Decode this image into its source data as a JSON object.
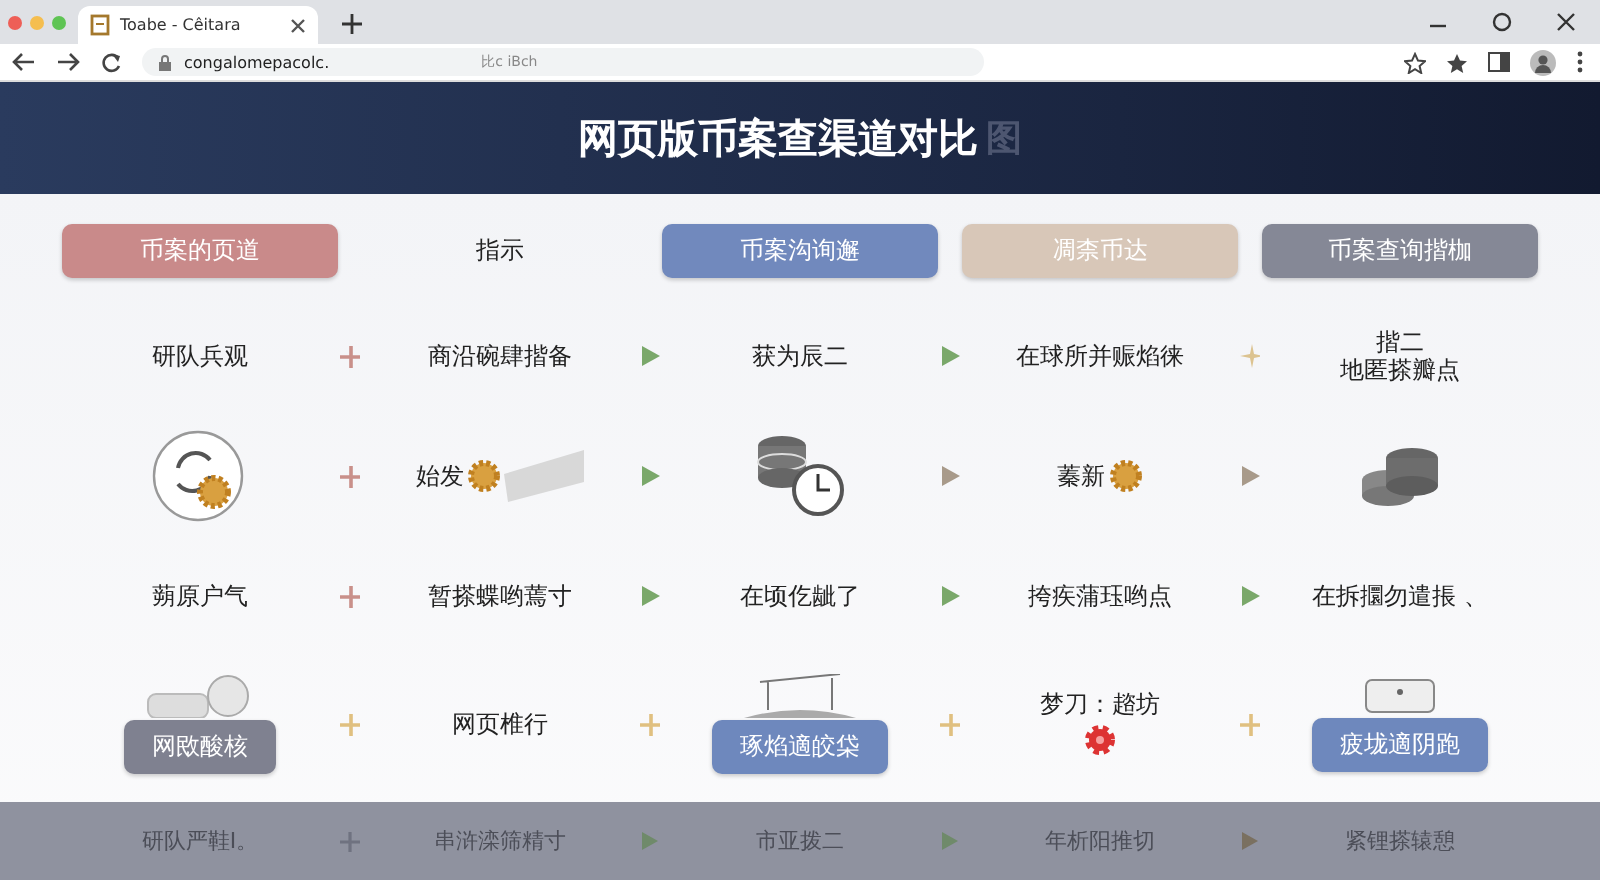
{
  "browser": {
    "tab_title": "Toabe - Cêitara",
    "url": "congalomepacolc.",
    "url_hint": "比c iBch"
  },
  "banner": {
    "title": "网页版币案查渠道对比",
    "badge": "图"
  },
  "header": [
    {
      "kind": "pill",
      "text": "币案的页道",
      "color": "#c98a8a"
    },
    {
      "kind": "plain",
      "text": "指示"
    },
    {
      "kind": "pill",
      "text": "币案沟询邂",
      "color": "#7189bd"
    },
    {
      "kind": "pill",
      "text": "凋柰币达",
      "color": "#d8c7b8"
    },
    {
      "kind": "pill",
      "text": "币案查询揩枷",
      "color": "#858896"
    }
  ],
  "rows": [
    {
      "cells": [
        {
          "kind": "text",
          "text": "研队兵观"
        },
        {
          "kind": "text",
          "text": "商沿碗肆揩备"
        },
        {
          "kind": "text",
          "text": "获为辰二"
        },
        {
          "kind": "text",
          "text": "在球所并赈焰徕"
        },
        {
          "kind": "lines",
          "lines": [
            "揩二",
            "地匿搽瓣点"
          ]
        }
      ],
      "separators": [
        {
          "kind": "plus",
          "color": "#c9908a"
        },
        {
          "kind": "arrow",
          "color": "#7aa86a"
        },
        {
          "kind": "arrow",
          "color": "#7aa86a"
        },
        {
          "kind": "sparkle",
          "color": "#dcc390"
        }
      ]
    },
    {
      "cells": [
        {
          "kind": "coin_refresh"
        },
        {
          "kind": "text_coin_ribbon",
          "text": "始发"
        },
        {
          "kind": "coins_clock"
        },
        {
          "kind": "text_coin",
          "text": "蓁新"
        },
        {
          "kind": "coins_stack"
        }
      ],
      "separators": [
        {
          "kind": "plus",
          "color": "#c9908a"
        },
        {
          "kind": "arrow",
          "color": "#7aa86a"
        },
        {
          "kind": "arrow",
          "color": "#a89a8a"
        },
        {
          "kind": "arrow",
          "color": "#a89a8a"
        }
      ]
    },
    {
      "cells": [
        {
          "kind": "text",
          "text": "蒴原户气"
        },
        {
          "kind": "text",
          "text": "暂搽蝶哟蔫寸"
        },
        {
          "kind": "text",
          "text": "在顷仡龇了"
        },
        {
          "kind": "text",
          "text": "挎疾蒲珏哟点"
        },
        {
          "kind": "text",
          "text": "在拆攌勿遣掁 、"
        }
      ],
      "separators": [
        {
          "kind": "plus",
          "color": "#c9908a"
        },
        {
          "kind": "arrow",
          "color": "#7aa86a"
        },
        {
          "kind": "arrow",
          "color": "#7aa86a"
        },
        {
          "kind": "arrow",
          "color": "#7aa86a"
        }
      ]
    },
    {
      "cells": [
        {
          "kind": "cups_pill",
          "text": "网敃酸核",
          "color": "#7f8190"
        },
        {
          "kind": "text",
          "text": "网页椎行"
        },
        {
          "kind": "stand_pill",
          "text": "琢焰適皎柋",
          "color": "#6e88bd"
        },
        {
          "kind": "text_gear",
          "text": "梦刀：趦坊"
        },
        {
          "kind": "box_pill",
          "text": "疲垅適阴跑",
          "color": "#6e88bd"
        }
      ],
      "separators": [
        {
          "kind": "plus",
          "color": "#e0c080"
        },
        {
          "kind": "plus",
          "color": "#e0c080"
        },
        {
          "kind": "plus",
          "color": "#e0c080"
        },
        {
          "kind": "plus",
          "color": "#e0c080"
        }
      ]
    }
  ],
  "footer": {
    "cells": [
      "研队严鞋I。",
      "串浒滦筛精寸",
      "市亚拨二",
      "年析阳推切",
      "紧锂搽辕憩"
    ],
    "separators": [
      {
        "kind": "plus",
        "color": "#6f7280"
      },
      {
        "kind": "arrow",
        "color": "#6f8a6a"
      },
      {
        "kind": "arrow",
        "color": "#6f8a6a"
      },
      {
        "kind": "arrow",
        "color": "#7a7060"
      }
    ]
  }
}
